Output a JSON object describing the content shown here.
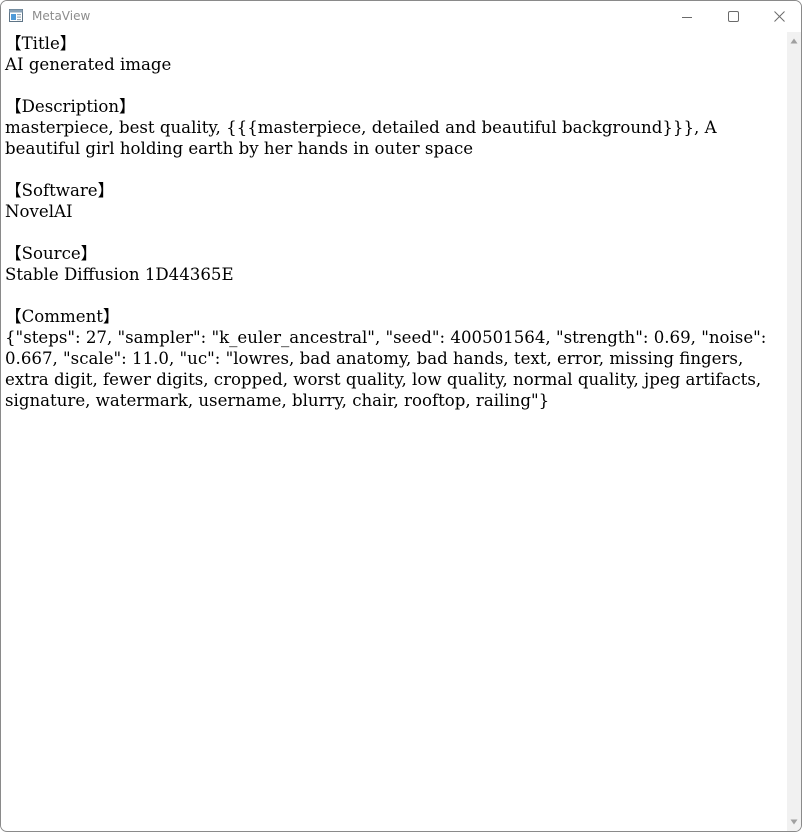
{
  "window": {
    "title": "MetaView",
    "app_icon": "image-viewer-icon",
    "controls": {
      "minimize_icon": "minimize-icon",
      "maximize_icon": "maximize-icon",
      "close_icon": "close-icon"
    }
  },
  "metadata_text": "【Title】\nAI generated image\n\n【Description】\nmasterpiece, best quality, {{{masterpiece, detailed and beautiful background}}}, A beautiful girl holding earth by her hands in outer space\n\n【Software】\nNovelAI\n\n【Source】\nStable Diffusion 1D44365E\n\n【Comment】\n{\"steps\": 27, \"sampler\": \"k_euler_ancestral\", \"seed\": 400501564, \"strength\": 0.69, \"noise\": 0.667, \"scale\": 11.0, \"uc\": \"lowres, bad anatomy, bad hands, text, error, missing fingers, extra digit, fewer digits, cropped, worst quality, low quality, normal quality, jpeg artifacts, signature, watermark, username, blurry, chair, rooftop, railing\"}",
  "scrollbar": {
    "up_icon": "scroll-up-arrow-icon",
    "down_icon": "scroll-down-arrow-icon"
  },
  "colors": {
    "title_text": "#8c8c8c",
    "text": "#000000",
    "background": "#ffffff",
    "scrollbar_track": "#f1f1f1",
    "scrollbar_arrow": "#a0a0a0"
  }
}
